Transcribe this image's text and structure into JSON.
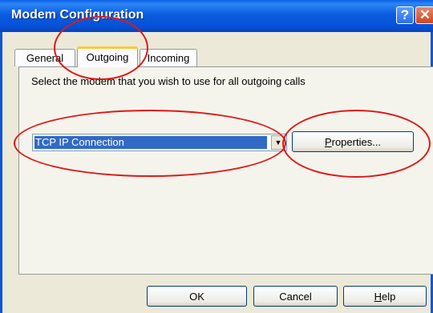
{
  "window": {
    "title": "Modem Configuration",
    "help_glyph": "?",
    "close_glyph": "✕"
  },
  "tabs": [
    {
      "label": "General",
      "selected": false
    },
    {
      "label": "Outgoing",
      "selected": true
    },
    {
      "label": "Incoming",
      "selected": false
    }
  ],
  "outgoing": {
    "instructions": "Select the modem that you wish to use for all outgoing calls",
    "modem_select": {
      "value": "TCP IP Connection"
    },
    "properties_button": {
      "mnemonic": "P",
      "rest": "roperties..."
    }
  },
  "buttons": {
    "ok": "OK",
    "cancel": "Cancel",
    "help_mnemonic": "H",
    "help_rest": "elp"
  },
  "colors": {
    "annotation_red": "#e01818",
    "titlebar_blue": "#0a5ce0",
    "selection_blue": "#316ac5"
  }
}
